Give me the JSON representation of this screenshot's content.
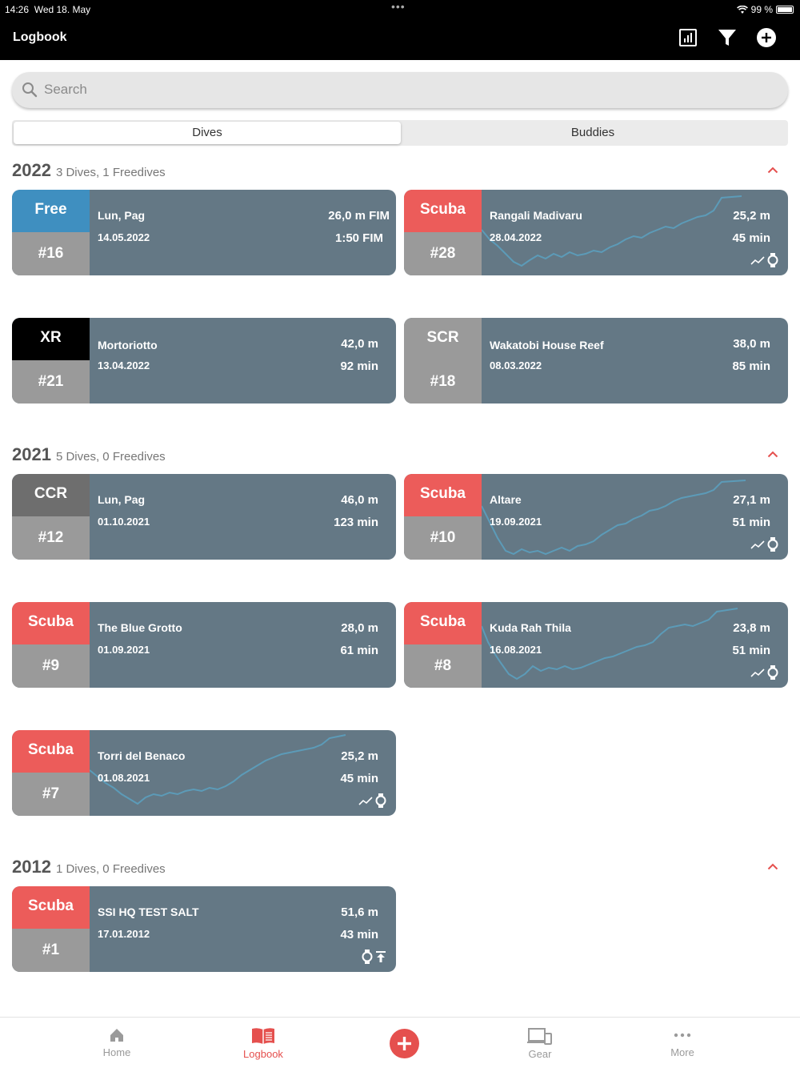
{
  "status_bar": {
    "time": "14:26",
    "date": "Wed 18. May",
    "battery": "99 %"
  },
  "header": {
    "title": "Logbook"
  },
  "search": {
    "placeholder": "Search"
  },
  "segments": {
    "dives": "Dives",
    "buddies": "Buddies"
  },
  "colors": {
    "free": "#3f8fc0",
    "scuba": "#ec5c5a",
    "xr": "#000000",
    "scr": "#9a9a9a",
    "ccr": "#6e6e6e",
    "card": "#647885",
    "accent": "#e5504e"
  },
  "sections": [
    {
      "year": "2022",
      "summary": "3 Dives, 1 Freedives",
      "dives": [
        {
          "type": "Free",
          "number": "#16",
          "site": "Lun, Pag",
          "date": "14.05.2022",
          "depth": "26,0 m FIM",
          "duration": "1:50 FIM",
          "profile": false
        },
        {
          "type": "Scuba",
          "number": "#28",
          "site": "Rangali Madivaru",
          "date": "28.04.2022",
          "depth": "25,2 m",
          "duration": "45 min",
          "profile": true
        },
        {
          "type": "XR",
          "number": "#21",
          "site": "Mortoriotto",
          "date": "13.04.2022",
          "depth": "42,0 m",
          "duration": "92 min",
          "profile": false
        },
        {
          "type": "SCR",
          "number": "#18",
          "site": "Wakatobi House Reef",
          "date": "08.03.2022",
          "depth": "38,0 m",
          "duration": "85 min",
          "profile": false
        }
      ]
    },
    {
      "year": "2021",
      "summary": "5 Dives, 0 Freedives",
      "dives": [
        {
          "type": "CCR",
          "number": "#12",
          "site": "Lun, Pag",
          "date": "01.10.2021",
          "depth": "46,0 m",
          "duration": "123 min",
          "profile": false
        },
        {
          "type": "Scuba",
          "number": "#10",
          "site": "Altare",
          "date": "19.09.2021",
          "depth": "27,1 m",
          "duration": "51 min",
          "profile": true
        },
        {
          "type": "Scuba",
          "number": "#9",
          "site": "The Blue Grotto",
          "date": "01.09.2021",
          "depth": "28,0 m",
          "duration": "61 min",
          "profile": false
        },
        {
          "type": "Scuba",
          "number": "#8",
          "site": "Kuda Rah Thila",
          "date": "16.08.2021",
          "depth": "23,8 m",
          "duration": "51 min",
          "profile": true
        },
        {
          "type": "Scuba",
          "number": "#7",
          "site": "Torri del Benaco",
          "date": "01.08.2021",
          "depth": "25,2 m",
          "duration": "45 min",
          "profile": true
        }
      ]
    },
    {
      "year": "2012",
      "summary": "1 Dives, 0 Freedives",
      "dives": [
        {
          "type": "Scuba",
          "number": "#1",
          "site": "SSI HQ TEST SALT",
          "date": "17.01.2012",
          "depth": "51,6 m",
          "duration": "43 min",
          "profile": false
        }
      ]
    }
  ],
  "tabbar": {
    "home": "Home",
    "logbook": "Logbook",
    "gear": "Gear",
    "more": "More"
  }
}
